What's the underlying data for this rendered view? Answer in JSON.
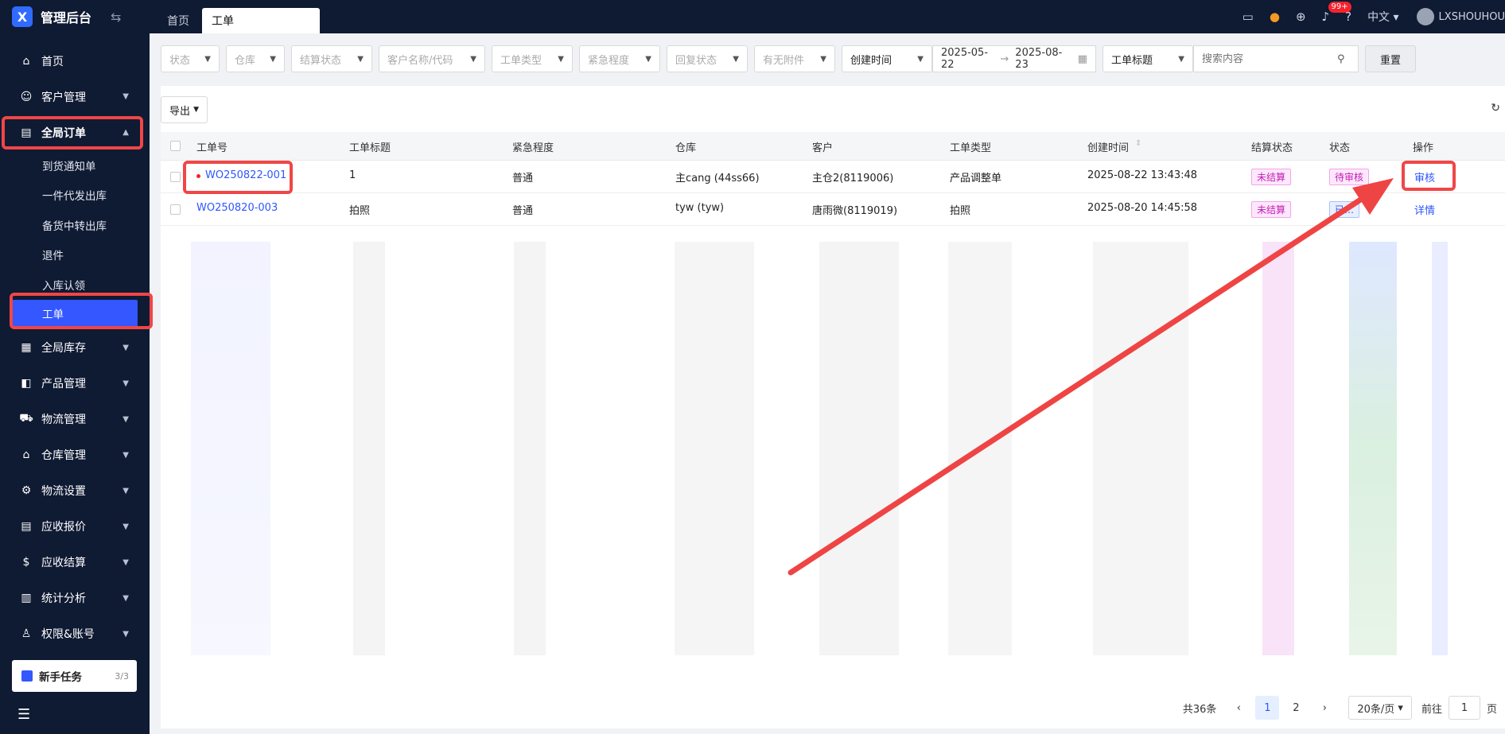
{
  "brand": {
    "title": "管理后台",
    "logo_glyph": "X"
  },
  "tabs": [
    {
      "label": "首页"
    },
    {
      "label": "工单"
    }
  ],
  "topbar": {
    "badge": "99+",
    "lang": "中文",
    "user": "LXSHOUHOU"
  },
  "sidebar": {
    "items": [
      {
        "label": "首页",
        "icon": "home-icon"
      },
      {
        "label": "客户管理",
        "icon": "customer-icon"
      },
      {
        "label": "全局订单",
        "icon": "order-icon"
      },
      {
        "label": "全局库存",
        "icon": "inventory-icon"
      },
      {
        "label": "产品管理",
        "icon": "product-icon"
      },
      {
        "label": "物流管理",
        "icon": "truck-icon"
      },
      {
        "label": "仓库管理",
        "icon": "warehouse-icon"
      },
      {
        "label": "物流设置",
        "icon": "logistics-settings-icon"
      },
      {
        "label": "应收报价",
        "icon": "quote-icon"
      },
      {
        "label": "应收结算",
        "icon": "settlement-icon"
      },
      {
        "label": "统计分析",
        "icon": "stats-icon"
      },
      {
        "label": "权限&账号",
        "icon": "permission-icon"
      }
    ],
    "subitems": [
      {
        "label": "到货通知单"
      },
      {
        "label": "一件代发出库"
      },
      {
        "label": "备货中转出库"
      },
      {
        "label": "退件"
      },
      {
        "label": "入库认领"
      },
      {
        "label": "工单"
      }
    ],
    "newbie": {
      "label": "新手任务",
      "count": "3/3"
    }
  },
  "filters": {
    "status": "状态",
    "warehouse": "仓库",
    "settle": "结算状态",
    "customer": "客户名称/代码",
    "type": "工单类型",
    "urgency": "紧急程度",
    "reply": "回复状态",
    "attachment": "有无附件",
    "time_field": "创建时间",
    "date_start": "2025-05-22",
    "date_end": "2025-08-23",
    "title_field": "工单标题",
    "search_placeholder": "搜索内容",
    "reset": "重置"
  },
  "toolbar": {
    "export": "导出"
  },
  "table": {
    "headers": [
      "工单号",
      "工单标题",
      "紧急程度",
      "仓库",
      "客户",
      "工单类型",
      "创建时间",
      "结算状态",
      "状态",
      "操作"
    ],
    "rows": [
      {
        "no": "WO250822-001",
        "title": "1",
        "urgency": "普通",
        "warehouse": "主cang (44ss66)",
        "customer": "主仓2(8119006)",
        "type": "产品调整单",
        "time": "2025-08-22 13:43:48",
        "settle": "未结算",
        "status": "待审核",
        "action": "审核"
      },
      {
        "no": "WO250820-003",
        "title": "拍照",
        "urgency": "普通",
        "warehouse": "tyw (tyw)",
        "customer": "唐雨微(8119019)",
        "type": "拍照",
        "time": "2025-08-20 14:45:58",
        "settle": "未结算",
        "status": "已…",
        "action": "详情"
      }
    ]
  },
  "pager": {
    "total": "共36条",
    "page1": "1",
    "page2": "2",
    "size": "20条/页",
    "goto": "前往",
    "page_input": "1",
    "page_unit": "页"
  },
  "colors": {
    "sidebar": "#0f1a33",
    "accent": "#3457ff",
    "highlight": "#f04646"
  }
}
